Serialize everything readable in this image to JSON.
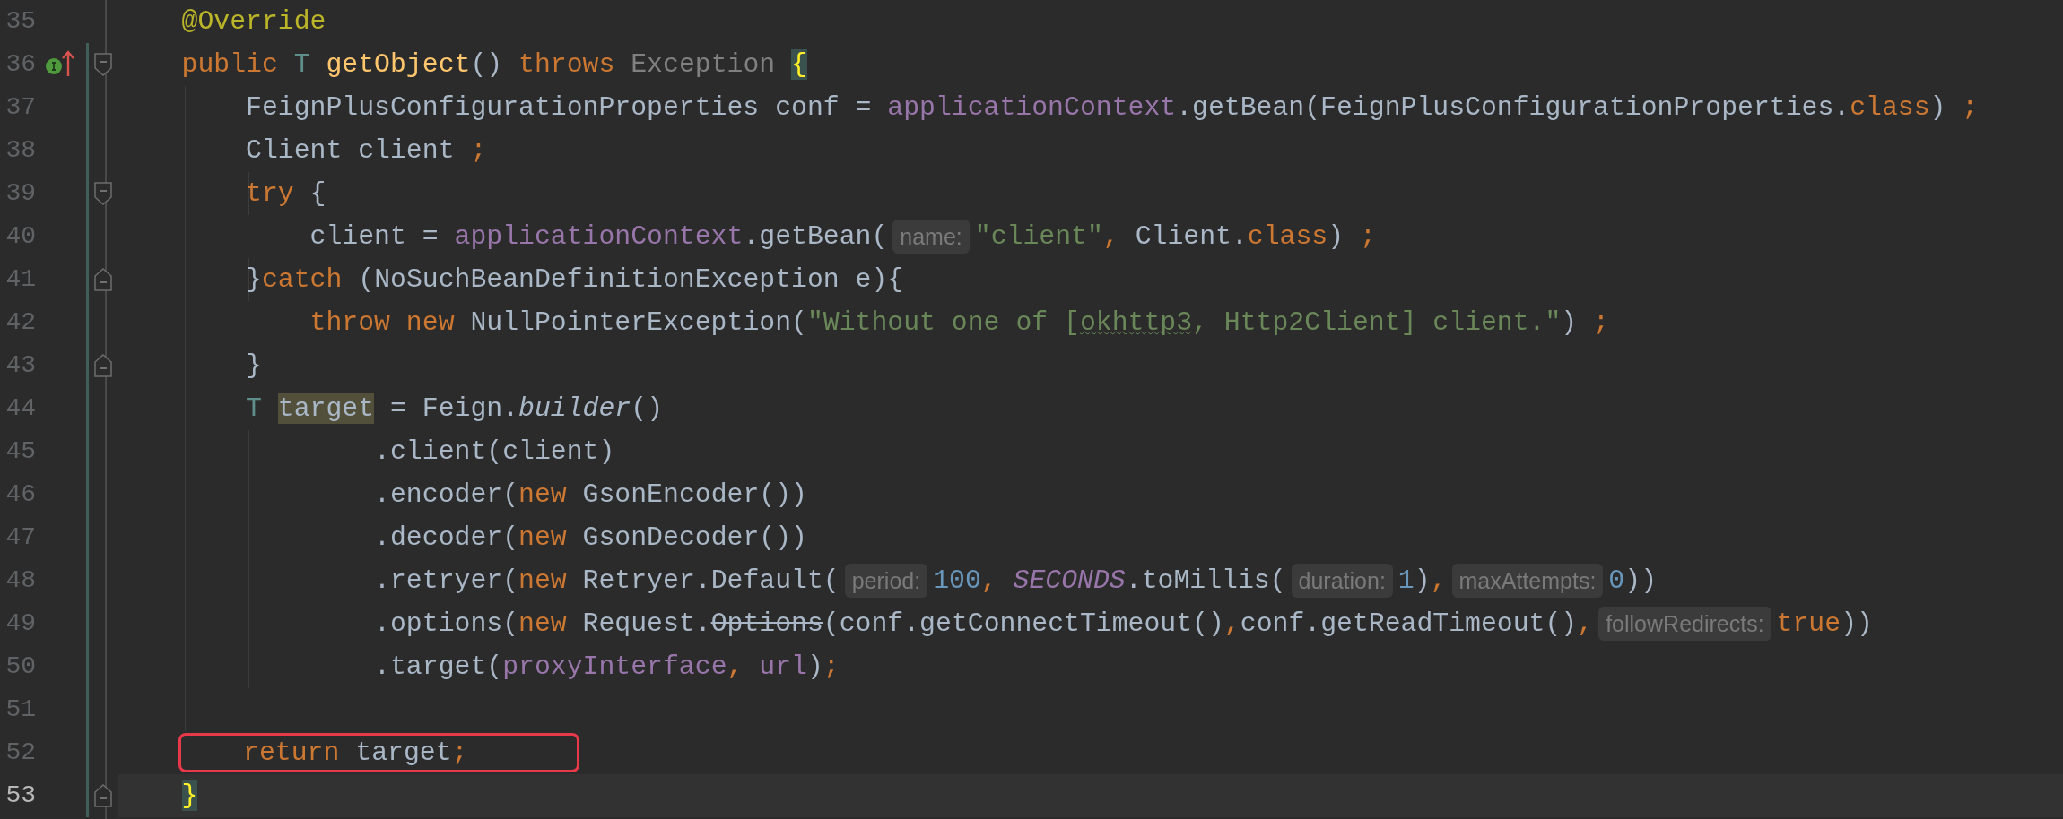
{
  "editor": {
    "lines": [
      {
        "number": "35",
        "current": false,
        "boxed": false,
        "changed": false,
        "override_marker": false,
        "fold_start": false,
        "fold_end": false,
        "segments": [
          {
            "kind": "code",
            "tokens": [
              {
                "text": "    @Override",
                "kind": "annotation"
              }
            ]
          }
        ]
      },
      {
        "number": "36",
        "current": false,
        "boxed": false,
        "changed": true,
        "override_marker": true,
        "fold_start": true,
        "fold_end": false,
        "segments": [
          {
            "kind": "code",
            "tokens": [
              {
                "text": "    public ",
                "kind": "keyword"
              },
              {
                "text": "T ",
                "kind": "type_param"
              },
              {
                "text": "getObject",
                "kind": "method_decl"
              },
              {
                "text": "() ",
                "kind": "plain"
              },
              {
                "text": "throws ",
                "kind": "keyword"
              },
              {
                "text": "Exception ",
                "kind": "muted"
              },
              {
                "text": "{",
                "kind": "brace_match"
              }
            ]
          }
        ]
      },
      {
        "number": "37",
        "current": false,
        "boxed": false,
        "changed": true,
        "override_marker": false,
        "fold_start": false,
        "fold_end": false,
        "segments": [
          {
            "kind": "code",
            "tokens": [
              {
                "text": "        FeignPlusConfigurationProperties conf = ",
                "kind": "plain"
              },
              {
                "text": "applicationContext",
                "kind": "field"
              },
              {
                "text": ".getBean(FeignPlusConfigurationProperties.",
                "kind": "plain"
              },
              {
                "text": "class",
                "kind": "keyword"
              },
              {
                "text": ") ",
                "kind": "plain"
              },
              {
                "text": ";",
                "kind": "keyword"
              }
            ]
          }
        ]
      },
      {
        "number": "38",
        "current": false,
        "boxed": false,
        "changed": true,
        "override_marker": false,
        "fold_start": false,
        "fold_end": false,
        "segments": [
          {
            "kind": "code",
            "tokens": [
              {
                "text": "        Client client ",
                "kind": "plain"
              },
              {
                "text": ";",
                "kind": "keyword"
              }
            ]
          }
        ]
      },
      {
        "number": "39",
        "current": false,
        "boxed": false,
        "changed": true,
        "override_marker": false,
        "fold_start": true,
        "fold_end": false,
        "segments": [
          {
            "kind": "code",
            "tokens": [
              {
                "text": "        try",
                "kind": "keyword"
              },
              {
                "text": " {",
                "kind": "plain"
              }
            ]
          }
        ]
      },
      {
        "number": "40",
        "current": false,
        "boxed": false,
        "changed": true,
        "override_marker": false,
        "fold_start": false,
        "fold_end": false,
        "segments": [
          {
            "kind": "code",
            "tokens": [
              {
                "text": "            client = ",
                "kind": "plain"
              },
              {
                "text": "applicationContext",
                "kind": "field"
              },
              {
                "text": ".getBean(",
                "kind": "plain"
              }
            ]
          },
          {
            "kind": "hint",
            "text": "name:"
          },
          {
            "kind": "code",
            "tokens": [
              {
                "text": "\"client\"",
                "kind": "string"
              },
              {
                "text": ",",
                "kind": "keyword"
              },
              {
                "text": " Client.",
                "kind": "plain"
              },
              {
                "text": "class",
                "kind": "keyword"
              },
              {
                "text": ") ",
                "kind": "plain"
              },
              {
                "text": ";",
                "kind": "keyword"
              }
            ]
          }
        ]
      },
      {
        "number": "41",
        "current": false,
        "boxed": false,
        "changed": true,
        "override_marker": false,
        "fold_start": false,
        "fold_end": true,
        "segments": [
          {
            "kind": "code",
            "tokens": [
              {
                "text": "        }",
                "kind": "plain"
              },
              {
                "text": "catch",
                "kind": "keyword"
              },
              {
                "text": " (NoSuchBeanDefinitionException e){",
                "kind": "plain"
              }
            ]
          }
        ]
      },
      {
        "number": "42",
        "current": false,
        "boxed": false,
        "changed": true,
        "override_marker": false,
        "fold_start": false,
        "fold_end": false,
        "segments": [
          {
            "kind": "code",
            "tokens": [
              {
                "text": "            throw new",
                "kind": "keyword"
              },
              {
                "text": " NullPointerException(",
                "kind": "plain"
              },
              {
                "text": "\"Without one of [",
                "kind": "string"
              },
              {
                "text": "okhttp3",
                "kind": "string_typo"
              },
              {
                "text": ", Http2Client] client.\"",
                "kind": "string"
              },
              {
                "text": ") ",
                "kind": "plain"
              },
              {
                "text": ";",
                "kind": "keyword"
              }
            ]
          }
        ]
      },
      {
        "number": "43",
        "current": false,
        "boxed": false,
        "changed": true,
        "override_marker": false,
        "fold_start": false,
        "fold_end": true,
        "segments": [
          {
            "kind": "code",
            "tokens": [
              {
                "text": "        }",
                "kind": "plain"
              }
            ]
          }
        ]
      },
      {
        "number": "44",
        "current": false,
        "boxed": false,
        "changed": true,
        "override_marker": false,
        "fold_start": false,
        "fold_end": false,
        "segments": [
          {
            "kind": "code",
            "tokens": [
              {
                "text": "        T ",
                "kind": "type_param"
              },
              {
                "text": "target",
                "kind": "usage"
              },
              {
                "text": " = Feign.",
                "kind": "plain"
              },
              {
                "text": "builder",
                "kind": "italic"
              },
              {
                "text": "()",
                "kind": "plain"
              }
            ]
          }
        ]
      },
      {
        "number": "45",
        "current": false,
        "boxed": false,
        "changed": true,
        "override_marker": false,
        "fold_start": false,
        "fold_end": false,
        "segments": [
          {
            "kind": "code",
            "tokens": [
              {
                "text": "                .client(client)",
                "kind": "plain"
              }
            ]
          }
        ]
      },
      {
        "number": "46",
        "current": false,
        "boxed": false,
        "changed": true,
        "override_marker": false,
        "fold_start": false,
        "fold_end": false,
        "segments": [
          {
            "kind": "code",
            "tokens": [
              {
                "text": "                .encoder(",
                "kind": "plain"
              },
              {
                "text": "new",
                "kind": "keyword"
              },
              {
                "text": " GsonEncoder())",
                "kind": "plain"
              }
            ]
          }
        ]
      },
      {
        "number": "47",
        "current": false,
        "boxed": false,
        "changed": true,
        "override_marker": false,
        "fold_start": false,
        "fold_end": false,
        "segments": [
          {
            "kind": "code",
            "tokens": [
              {
                "text": "                .decoder(",
                "kind": "plain"
              },
              {
                "text": "new",
                "kind": "keyword"
              },
              {
                "text": " GsonDecoder())",
                "kind": "plain"
              }
            ]
          }
        ]
      },
      {
        "number": "48",
        "current": false,
        "boxed": false,
        "changed": true,
        "override_marker": false,
        "fold_start": false,
        "fold_end": false,
        "segments": [
          {
            "kind": "code",
            "tokens": [
              {
                "text": "                .retryer(",
                "kind": "plain"
              },
              {
                "text": "new",
                "kind": "keyword"
              },
              {
                "text": " Retryer.Default(",
                "kind": "plain"
              }
            ]
          },
          {
            "kind": "hint",
            "text": "period:"
          },
          {
            "kind": "code",
            "tokens": [
              {
                "text": "100",
                "kind": "number"
              },
              {
                "text": ", ",
                "kind": "keyword"
              },
              {
                "text": "SECONDS",
                "kind": "static_field"
              },
              {
                "text": ".toMillis(",
                "kind": "plain"
              }
            ]
          },
          {
            "kind": "hint",
            "text": "duration:"
          },
          {
            "kind": "code",
            "tokens": [
              {
                "text": "1",
                "kind": "number"
              },
              {
                "text": ")",
                "kind": "plain"
              },
              {
                "text": ",",
                "kind": "keyword"
              }
            ]
          },
          {
            "kind": "hint",
            "text": "maxAttempts:"
          },
          {
            "kind": "code",
            "tokens": [
              {
                "text": "0",
                "kind": "number"
              },
              {
                "text": "))",
                "kind": "plain"
              }
            ]
          }
        ]
      },
      {
        "number": "49",
        "current": false,
        "boxed": false,
        "changed": true,
        "override_marker": false,
        "fold_start": false,
        "fold_end": false,
        "segments": [
          {
            "kind": "code",
            "tokens": [
              {
                "text": "                .options(",
                "kind": "plain"
              },
              {
                "text": "new",
                "kind": "keyword"
              },
              {
                "text": " Request.",
                "kind": "plain"
              },
              {
                "text": "Options",
                "kind": "deprecated"
              },
              {
                "text": "(conf.getConnectTimeout()",
                "kind": "plain"
              },
              {
                "text": ",",
                "kind": "keyword"
              },
              {
                "text": "conf.getReadTimeout()",
                "kind": "plain"
              },
              {
                "text": ",",
                "kind": "keyword"
              }
            ]
          },
          {
            "kind": "hint",
            "text": "followRedirects:"
          },
          {
            "kind": "code",
            "tokens": [
              {
                "text": "true",
                "kind": "keyword"
              },
              {
                "text": "))",
                "kind": "plain"
              }
            ]
          }
        ]
      },
      {
        "number": "50",
        "current": false,
        "boxed": false,
        "changed": true,
        "override_marker": false,
        "fold_start": false,
        "fold_end": false,
        "segments": [
          {
            "kind": "code",
            "tokens": [
              {
                "text": "                .target(",
                "kind": "plain"
              },
              {
                "text": "proxyInterface",
                "kind": "field"
              },
              {
                "text": ", ",
                "kind": "keyword"
              },
              {
                "text": "url",
                "kind": "field"
              },
              {
                "text": ")",
                "kind": "plain"
              },
              {
                "text": ";",
                "kind": "keyword"
              }
            ]
          }
        ]
      },
      {
        "number": "51",
        "current": false,
        "boxed": false,
        "changed": true,
        "override_marker": false,
        "fold_start": false,
        "fold_end": false
      },
      {
        "number": "52",
        "current": false,
        "boxed": true,
        "changed": true,
        "override_marker": false,
        "fold_start": false,
        "fold_end": false,
        "segments": [
          {
            "kind": "code",
            "tokens": [
              {
                "text": "        return",
                "kind": "keyword"
              },
              {
                "text": " target",
                "kind": "plain"
              },
              {
                "text": ";",
                "kind": "keyword"
              }
            ]
          }
        ]
      },
      {
        "number": "53",
        "current": true,
        "boxed": false,
        "changed": true,
        "override_marker": false,
        "fold_start": false,
        "fold_end": true,
        "segments": [
          {
            "kind": "code",
            "tokens": [
              {
                "text": "    }",
                "kind": "brace_match"
              }
            ]
          }
        ]
      }
    ]
  }
}
